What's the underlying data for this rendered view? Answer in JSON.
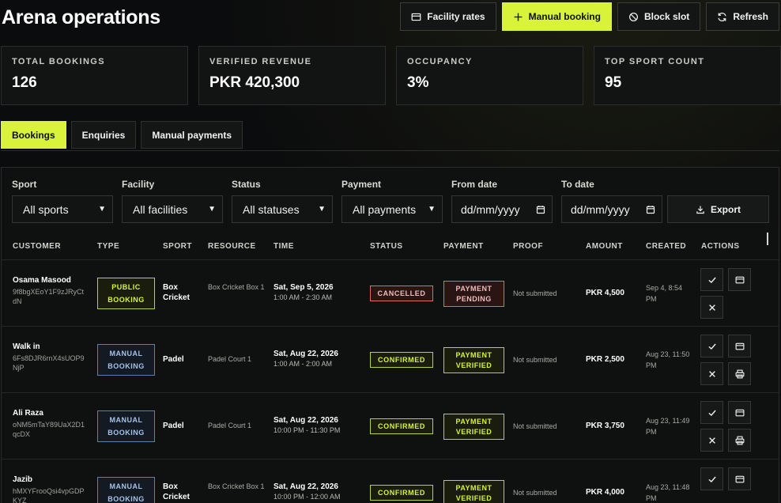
{
  "page": {
    "title": "Arena operations"
  },
  "toolbar": {
    "facility_rates": "Facility rates",
    "manual_booking": "Manual booking",
    "block_slot": "Block slot",
    "refresh": "Refresh"
  },
  "stats": [
    {
      "label": "TOTAL BOOKINGS",
      "value": "126"
    },
    {
      "label": "VERIFIED REVENUE",
      "value": "PKR 420,300"
    },
    {
      "label": "OCCUPANCY",
      "value": "3%"
    },
    {
      "label": "TOP SPORT COUNT",
      "value": "95"
    }
  ],
  "tabs": [
    {
      "label": "Bookings",
      "active": true
    },
    {
      "label": "Enquiries",
      "active": false
    },
    {
      "label": "Manual payments",
      "active": false
    }
  ],
  "filters": {
    "sport": {
      "label": "Sport",
      "value": "All sports"
    },
    "facility": {
      "label": "Facility",
      "value": "All facilities"
    },
    "status": {
      "label": "Status",
      "value": "All statuses"
    },
    "payment": {
      "label": "Payment",
      "value": "All payments"
    },
    "from_date": {
      "label": "From date",
      "value": "dd/mm/yyyy"
    },
    "to_date": {
      "label": "To date",
      "value": "dd/mm/yyyy"
    },
    "export": "Export"
  },
  "table": {
    "headers": {
      "customer": "CUSTOMER",
      "type": "TYPE",
      "sport": "SPORT",
      "resource": "RESOURCE",
      "time": "TIME",
      "status": "STATUS",
      "payment": "PAYMENT",
      "proof": "PROOF",
      "amount": "AMOUNT",
      "created": "CREATED",
      "actions": "ACTIONS"
    },
    "rows": [
      {
        "name": "Osama Masood",
        "id": "9f8bgXEoY1F9zJRyCtdN",
        "type": "PUBLIC BOOKING",
        "sport": "Box Cricket",
        "resource": "Box Cricket Box 1",
        "date": "Sat, Sep 5, 2026",
        "range": "1:00 AM - 2:30 AM",
        "status": "CANCELLED",
        "payment": "PAYMENT PENDING",
        "proof": "Not submitted",
        "amount": "PKR 4,500",
        "created": "Sep 4, 8:54 PM"
      },
      {
        "name": "Walk in",
        "id": "6Fs8DJR6rnX4sUOP9NjP",
        "type": "MANUAL BOOKING",
        "sport": "Padel",
        "resource": "Padel Court 1",
        "date": "Sat, Aug 22, 2026",
        "range": "1:00 AM - 2:00 AM",
        "status": "CONFIRMED",
        "payment": "PAYMENT VERIFIED",
        "proof": "Not submitted",
        "amount": "PKR 2,500",
        "created": "Aug 23, 11:50 PM"
      },
      {
        "name": "Ali Raza",
        "id": "oNM5mTaY89UaX2D1qcDX",
        "type": "MANUAL BOOKING",
        "sport": "Padel",
        "resource": "Padel Court 1",
        "date": "Sat, Aug 22, 2026",
        "range": "10:00 PM - 11:30 PM",
        "status": "CONFIRMED",
        "payment": "PAYMENT VERIFIED",
        "proof": "Not submitted",
        "amount": "PKR 3,750",
        "created": "Aug 23, 11:49 PM"
      },
      {
        "name": "Jazib",
        "id": "hMXYFrooQsi4vpGDPKYZ",
        "type": "MANUAL BOOKING",
        "sport": "Box Cricket",
        "resource": "Box Cricket Box 1",
        "date": "Sat, Aug 22, 2026",
        "range": "10:00 PM - 12:00 AM",
        "status": "CONFIRMED",
        "payment": "PAYMENT VERIFIED",
        "proof": "Not submitted",
        "amount": "PKR 4,000",
        "created": "Aug 23, 11:48 PM"
      }
    ]
  },
  "colors": {
    "accent": "#d8f33a",
    "danger": "#d96b6b",
    "manual": "#a7c2e8",
    "background": "#0b0c0d"
  },
  "icons": {
    "facility_rates": "card-icon",
    "manual_booking": "plus-icon",
    "block_slot": "ban-icon",
    "refresh": "refresh-icon",
    "export": "download-icon"
  }
}
